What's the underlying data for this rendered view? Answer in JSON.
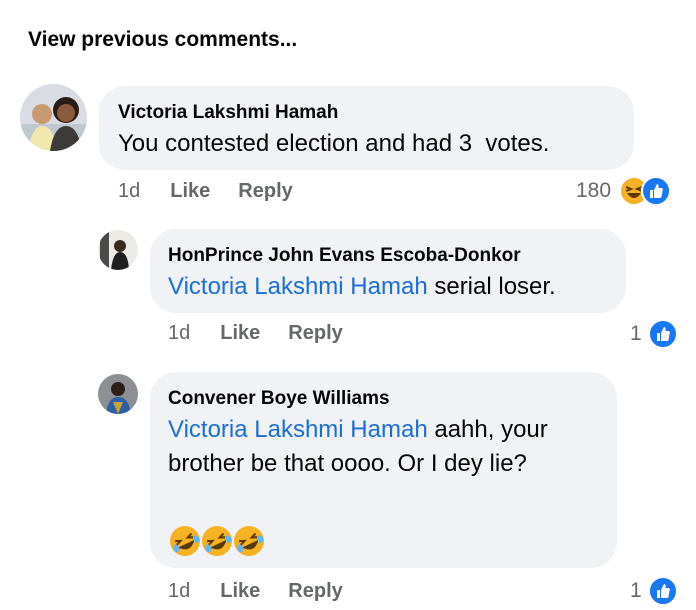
{
  "view_previous": "View previous comments...",
  "comments": [
    {
      "author": "Victoria Lakshmi Hamah",
      "text": "You contested election and had 3  votes.",
      "time": "1d",
      "like": "Like",
      "reply": "Reply",
      "reaction_count": "180",
      "reactions": [
        "haha-icon",
        "like-icon"
      ]
    },
    {
      "author": "HonPrince John Evans Escoba-Donkor",
      "mention": "Victoria Lakshmi Hamah",
      "text": " serial loser.",
      "time": "1d",
      "like": "Like",
      "reply": "Reply",
      "reaction_count": "1",
      "reactions": [
        "like-icon"
      ]
    },
    {
      "author": "Convener Boye Williams",
      "mention": "Victoria Lakshmi Hamah",
      "text_line1": " aahh, your",
      "text_line2": "brother be that oooo. Or I dey lie?",
      "emoji": "rolling-on-floor-laughing-emoji x3",
      "time": "1d",
      "like": "Like",
      "reply": "Reply",
      "reaction_count": "1",
      "reactions": [
        "like-icon"
      ]
    }
  ],
  "colors": {
    "mention": "#1a6ed8",
    "bubble": "#f0f2f5",
    "meta": "#65676b",
    "like": "#1877f2",
    "haha": "#f7b125"
  }
}
